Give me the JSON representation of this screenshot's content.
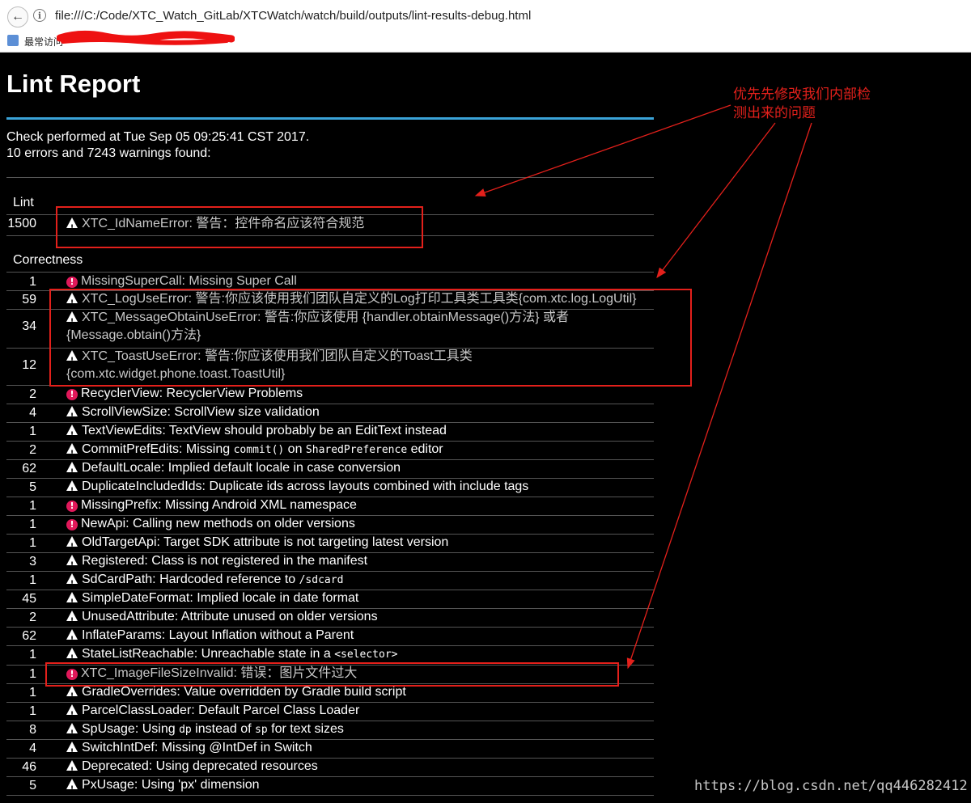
{
  "browser": {
    "url": "file:///C:/Code/XTC_Watch_GitLab/XTCWatch/watch/build/outputs/lint-results-debug.html",
    "bookmark_label": "最常访问"
  },
  "report": {
    "title": "Lint Report",
    "checked_line": "Check performed at Tue Sep 05 09:25:41 CST 2017.",
    "summary_line": "10 errors and 7243 warnings found:"
  },
  "categories": {
    "lint": "Lint",
    "correctness": "Correctness"
  },
  "rows": [
    {
      "count": "1500",
      "severity": "warning",
      "id": "XTC_IdNameError",
      "desc": "警告：控件命名应该符合规范"
    },
    {
      "count": "1",
      "severity": "error",
      "id": "MissingSuperCall",
      "desc": "Missing Super Call"
    },
    {
      "count": "59",
      "severity": "warning",
      "id": "XTC_LogUseError",
      "desc": "警告:你应该使用我们团队自定义的Log打印工具类工具类{com.xtc.log.LogUtil}"
    },
    {
      "count": "34",
      "severity": "warning",
      "id": "XTC_MessageObtainUseError",
      "desc": "警告:你应该使用 {handler.obtainMessage()方法} 或者",
      "desc2": "{Message.obtain()方法}"
    },
    {
      "count": "12",
      "severity": "warning",
      "id": "XTC_ToastUseError",
      "desc": "警告:你应该使用我们团队自定义的Toast工具类",
      "desc2": "{com.xtc.widget.phone.toast.ToastUtil}"
    },
    {
      "count": "2",
      "severity": "error",
      "id": "RecyclerView",
      "desc": "RecyclerView Problems"
    },
    {
      "count": "4",
      "severity": "warning",
      "id": "ScrollViewSize",
      "desc": "ScrollView size validation"
    },
    {
      "count": "1",
      "severity": "warning",
      "id": "TextViewEdits",
      "desc": "TextView should probably be an EditText instead"
    },
    {
      "count": "2",
      "severity": "warning",
      "id": "CommitPrefEdits",
      "desc_pre": "Missing ",
      "code1": "commit()",
      "desc_mid": " on ",
      "code2": "SharedPreference",
      "desc_post": " editor"
    },
    {
      "count": "62",
      "severity": "warning",
      "id": "DefaultLocale",
      "desc": "Implied default locale in case conversion"
    },
    {
      "count": "5",
      "severity": "warning",
      "id": "DuplicateIncludedIds",
      "desc": "Duplicate ids across layouts combined with include tags"
    },
    {
      "count": "1",
      "severity": "error",
      "id": "MissingPrefix",
      "desc": "Missing Android XML namespace"
    },
    {
      "count": "1",
      "severity": "error",
      "id": "NewApi",
      "desc": "Calling new methods on older versions"
    },
    {
      "count": "1",
      "severity": "warning",
      "id": "OldTargetApi",
      "desc": "Target SDK attribute is not targeting latest version"
    },
    {
      "count": "3",
      "severity": "warning",
      "id": "Registered",
      "desc": "Class is not registered in the manifest"
    },
    {
      "count": "1",
      "severity": "warning",
      "id": "SdCardPath",
      "desc_pre": "Hardcoded reference to ",
      "code1": "/sdcard"
    },
    {
      "count": "45",
      "severity": "warning",
      "id": "SimpleDateFormat",
      "desc": "Implied locale in date format"
    },
    {
      "count": "2",
      "severity": "warning",
      "id": "UnusedAttribute",
      "desc": "Attribute unused on older versions"
    },
    {
      "count": "62",
      "severity": "warning",
      "id": "InflateParams",
      "desc": "Layout Inflation without a Parent"
    },
    {
      "count": "1",
      "severity": "warning",
      "id": "StateListReachable",
      "desc_pre": "Unreachable state in a ",
      "code1": "<selector>"
    },
    {
      "count": "1",
      "severity": "error",
      "id": "XTC_ImageFileSizeInvalid",
      "desc": "错误：图片文件过大"
    },
    {
      "count": "1",
      "severity": "warning",
      "id": "GradleOverrides",
      "desc": "Value overridden by Gradle build script"
    },
    {
      "count": "1",
      "severity": "warning",
      "id": "ParcelClassLoader",
      "desc": "Default Parcel Class Loader"
    },
    {
      "count": "8",
      "severity": "warning",
      "id": "SpUsage",
      "desc_pre": "Using ",
      "code1": "dp",
      "desc_mid": " instead of ",
      "code2": "sp",
      "desc_post": " for text sizes"
    },
    {
      "count": "4",
      "severity": "warning",
      "id": "SwitchIntDef",
      "desc": "Missing @IntDef in Switch"
    },
    {
      "count": "46",
      "severity": "warning",
      "id": "Deprecated",
      "desc": "Using deprecated resources"
    },
    {
      "count": "5",
      "severity": "warning",
      "id": "PxUsage",
      "desc": "Using 'px' dimension"
    }
  ],
  "annotation": {
    "line1": "优先先修改我们内部检",
    "line2": "测出来的问题"
  },
  "watermark": "https://blog.csdn.net/qq446282412",
  "colors": {
    "background": "#000000",
    "accent_rule": "#3aa3d8",
    "error_icon": "#e0185a",
    "annotation_red": "#e3201b"
  }
}
